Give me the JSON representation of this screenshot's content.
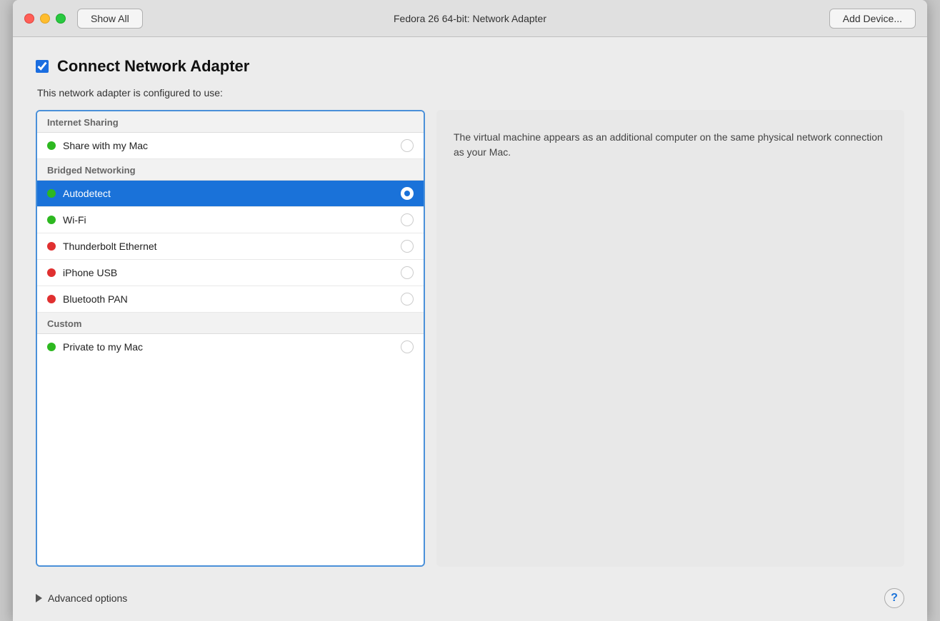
{
  "titlebar": {
    "show_all_label": "Show All",
    "title": "Fedora 26 64-bit: Network Adapter",
    "add_device_label": "Add Device..."
  },
  "header": {
    "connect_label": "Connect Network Adapter",
    "configured_text": "This network adapter is configured to use:"
  },
  "sections": [
    {
      "id": "internet_sharing",
      "header": "Internet Sharing",
      "items": [
        {
          "id": "share_mac",
          "label": "Share with my Mac",
          "dot": "green",
          "selected": false
        }
      ]
    },
    {
      "id": "bridged_networking",
      "header": "Bridged Networking",
      "items": [
        {
          "id": "autodetect",
          "label": "Autodetect",
          "dot": "green",
          "selected": true
        },
        {
          "id": "wifi",
          "label": "Wi-Fi",
          "dot": "green",
          "selected": false
        },
        {
          "id": "thunderbolt",
          "label": "Thunderbolt Ethernet",
          "dot": "red",
          "selected": false
        },
        {
          "id": "iphone_usb",
          "label": "iPhone USB",
          "dot": "red",
          "selected": false
        },
        {
          "id": "bluetooth",
          "label": "Bluetooth PAN",
          "dot": "red",
          "selected": false
        }
      ]
    },
    {
      "id": "custom",
      "header": "Custom",
      "items": [
        {
          "id": "private_mac",
          "label": "Private to my Mac",
          "dot": "green",
          "selected": false
        }
      ]
    }
  ],
  "description": {
    "text": "The virtual machine appears as an additional computer on the same physical network connection as your Mac."
  },
  "bottom": {
    "advanced_label": "Advanced options",
    "help_label": "?"
  }
}
